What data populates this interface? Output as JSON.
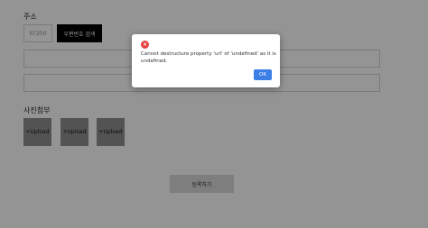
{
  "form": {
    "address_label": "주소",
    "zipcode_value": "07250",
    "search_button_label": "우편번호 검색",
    "photo_label": "사진첨부",
    "upload_label": "+Upload",
    "submit_label": "등록하기"
  },
  "dialog": {
    "message": "Cannot destructure property 'url' of 'undefined' as it is undefined.",
    "ok_label": "OK",
    "icon": "error-icon"
  }
}
